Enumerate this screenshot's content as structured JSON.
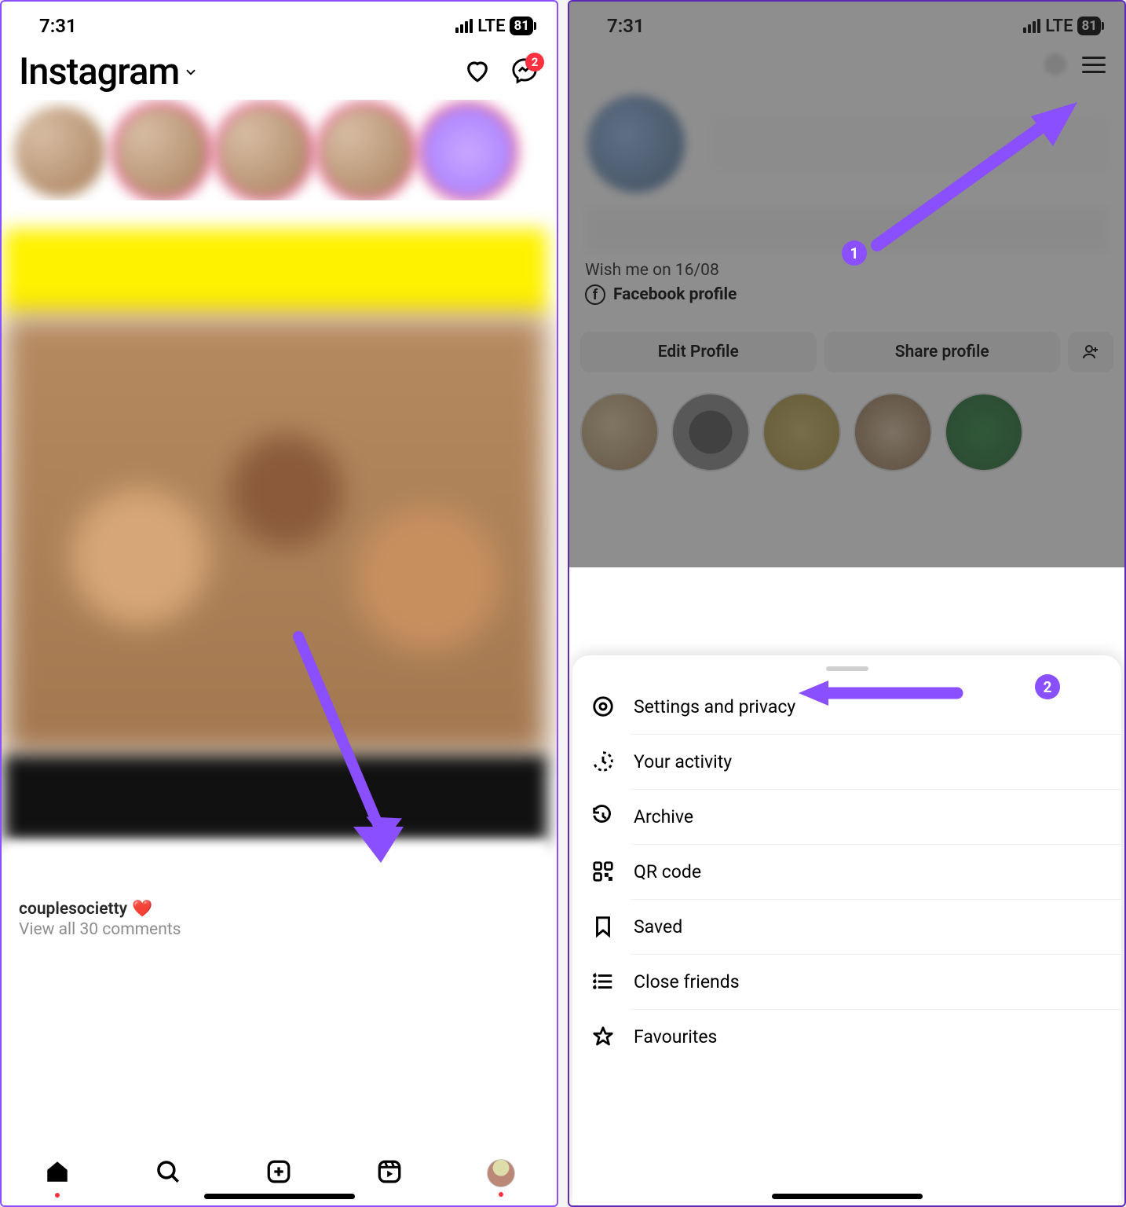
{
  "status": {
    "time": "7:31",
    "network": "LTE",
    "battery": "81"
  },
  "left": {
    "logo": "Instagram",
    "dm_badge": "2",
    "post": {
      "username": "couplesocietty",
      "emoji": "❤️",
      "view_comments": "View all 30 comments"
    }
  },
  "right": {
    "bio": "Wish me on 16/08",
    "fb_label": "Facebook profile",
    "buttons": {
      "edit": "Edit Profile",
      "share": "Share profile"
    },
    "sheet": [
      {
        "icon": "gear",
        "label": "Settings and privacy"
      },
      {
        "icon": "activity",
        "label": "Your activity"
      },
      {
        "icon": "archive",
        "label": "Archive"
      },
      {
        "icon": "qr",
        "label": "QR code"
      },
      {
        "icon": "bookmark",
        "label": "Saved"
      },
      {
        "icon": "closefriends",
        "label": "Close friends"
      },
      {
        "icon": "star",
        "label": "Favourites"
      }
    ]
  },
  "annotations": {
    "one": "1",
    "two": "2"
  }
}
